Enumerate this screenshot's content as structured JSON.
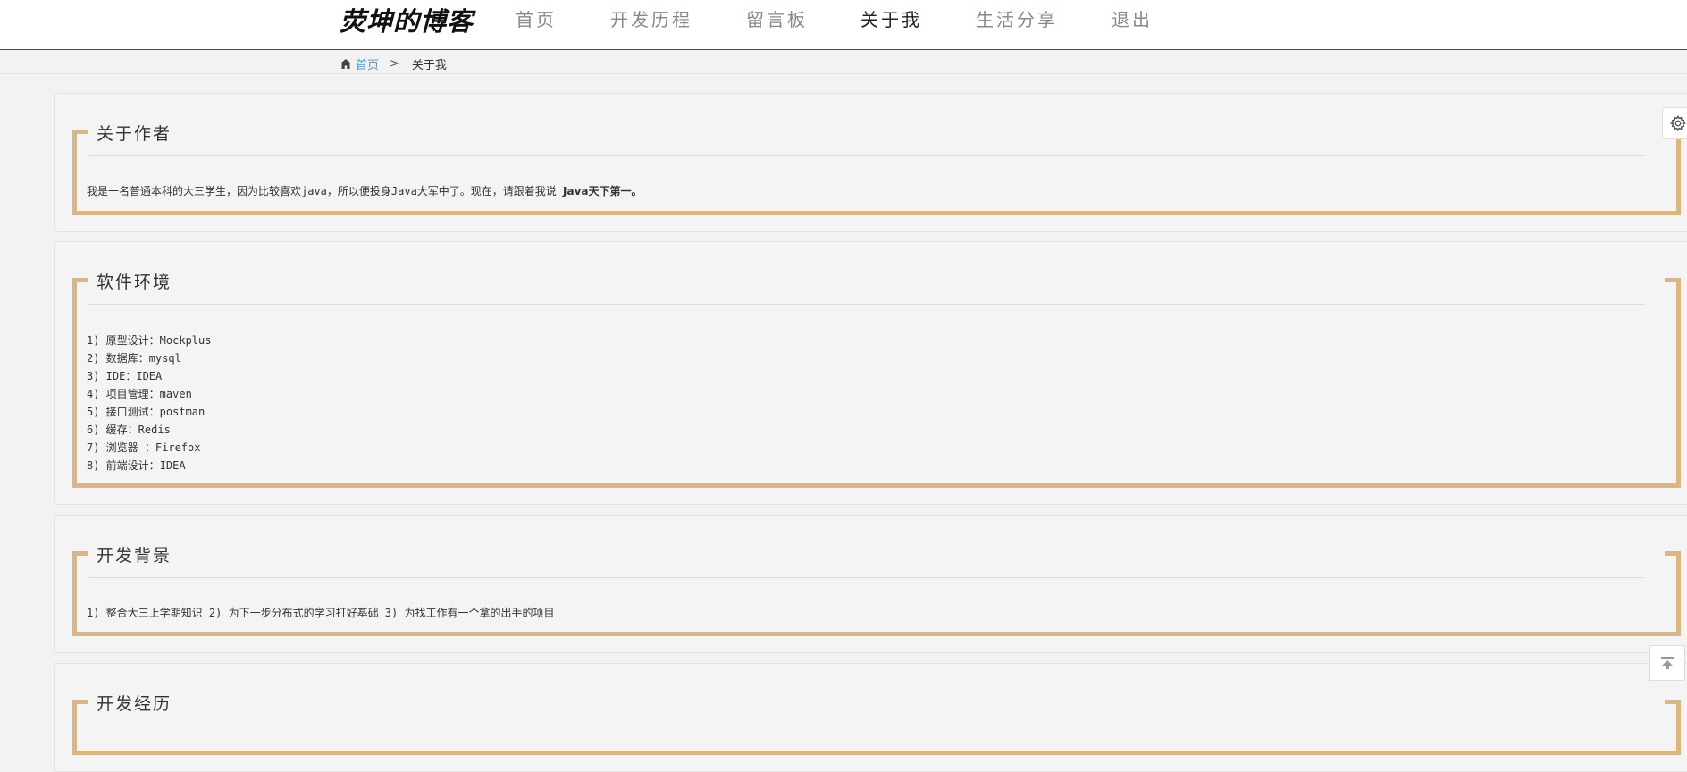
{
  "header": {
    "logo_text": "荧坤的博客",
    "nav": [
      {
        "label": "首页"
      },
      {
        "label": "开发历程"
      },
      {
        "label": "留言板"
      },
      {
        "label": "关于我"
      },
      {
        "label": "生活分享"
      },
      {
        "label": "退出"
      }
    ],
    "active_nav": "关于我"
  },
  "breadcrumb": {
    "home_label": "首页",
    "separator": ">",
    "current": "关于我"
  },
  "sections": {
    "author": {
      "title": "关于作者",
      "text": "我是一名普通本科的大三学生，因为比较喜欢java，所以便投身Java大军中了。现在，请跟着我说 ",
      "emphasis": "Java天下第一。"
    },
    "env": {
      "title": "软件环境",
      "items": [
        "1) 原型设计：Mockplus",
        "2) 数据库：mysql",
        "3) IDE：IDEA",
        "4) 项目管理：maven",
        "5) 接口测试：postman",
        "6) 缓存：Redis",
        "7) 浏览器 ：Firefox",
        "8) 前端设计：IDEA"
      ]
    },
    "background": {
      "title": "开发背景",
      "text": "1) 整合大三上学期知识 2) 为下一步分布式的学习打好基础 3) 为找工作有一个拿的出手的项目"
    },
    "experience": {
      "title": "开发经历"
    }
  },
  "icons": {
    "home": "home-icon",
    "settings": "gear-icon",
    "to_top": "back-to-top-icon"
  },
  "colors": {
    "accent_frame": "#ddb57f",
    "link": "#4a90d9",
    "page_bg": "#f2f2f2"
  }
}
